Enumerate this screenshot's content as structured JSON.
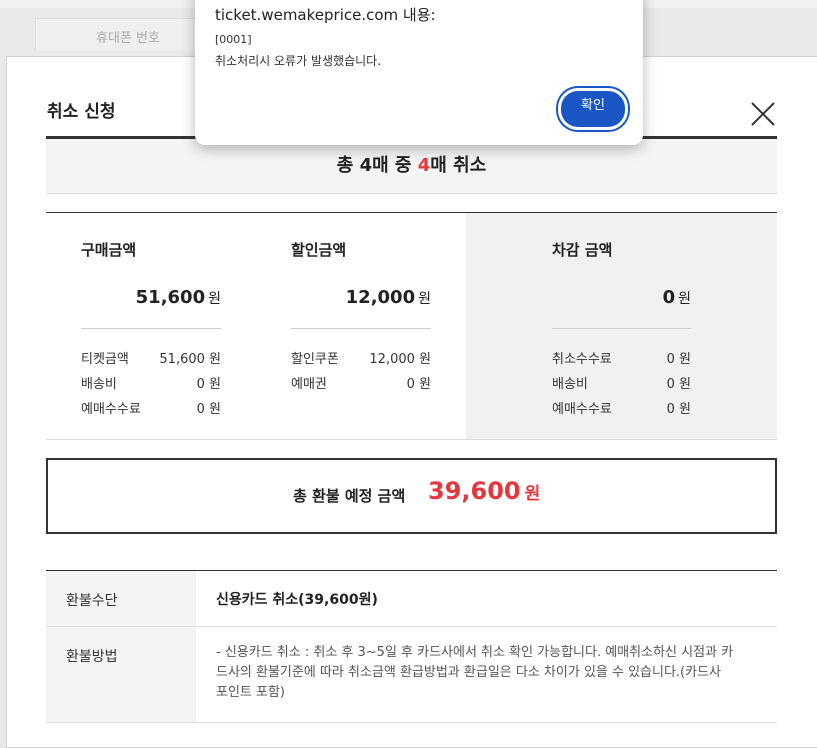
{
  "background": {
    "tab_label": "휴대폰 번호"
  },
  "modal": {
    "title": "총 4매 중 4매 취소",
    "heading": "취소 신청",
    "count": {
      "prefix": "총 4매 중 ",
      "highlight": "4",
      "suffix": "매 취소"
    },
    "purchase": {
      "label": "구매금액",
      "total": "51,600",
      "unit": "원",
      "rows": [
        {
          "label": "티켓금액",
          "value": "51,600 원"
        },
        {
          "label": "배송비",
          "value": "0 원"
        },
        {
          "label": "예매수수료",
          "value": "0 원"
        }
      ]
    },
    "discount": {
      "label": "할인금액",
      "total": "12,000",
      "unit": "원",
      "rows": [
        {
          "label": "할인쿠폰",
          "value": "12,000 원"
        },
        {
          "label": "예매권",
          "value": "0 원"
        }
      ]
    },
    "deduction": {
      "label": "차감 금액",
      "total": "0",
      "unit": "원",
      "rows": [
        {
          "label": "취소수수료",
          "value": "0 원"
        },
        {
          "label": "배송비",
          "value": "0 원"
        },
        {
          "label": "예매수수료",
          "value": "0 원"
        }
      ]
    },
    "refund": {
      "label": "총 환불 예정 금액",
      "value": "39,600",
      "unit": "원"
    },
    "info": [
      {
        "label": "환불수단",
        "value": "신용카드 취소(39,600원)"
      },
      {
        "label": "환불방법",
        "value": "- 신용카드 취소 : 취소 후 3~5일 후 카드사에서 취소 확인 가능합니다. 예매취소하신 시점과 카드사의 환불기준에 따라 취소금액 환급방법과 환급일은 다소 차이가 있을 수 있습니다.(카드사 포인트 포함)"
      }
    ]
  },
  "dialog": {
    "title": "ticket.wemakeprice.com 내용:",
    "code": "[0001]",
    "message": "취소처리시 오류가 발생했습니다.",
    "ok_label": "확인"
  },
  "colors": {
    "accent_red": "#e4393c",
    "button_blue": "#1a57c4"
  }
}
